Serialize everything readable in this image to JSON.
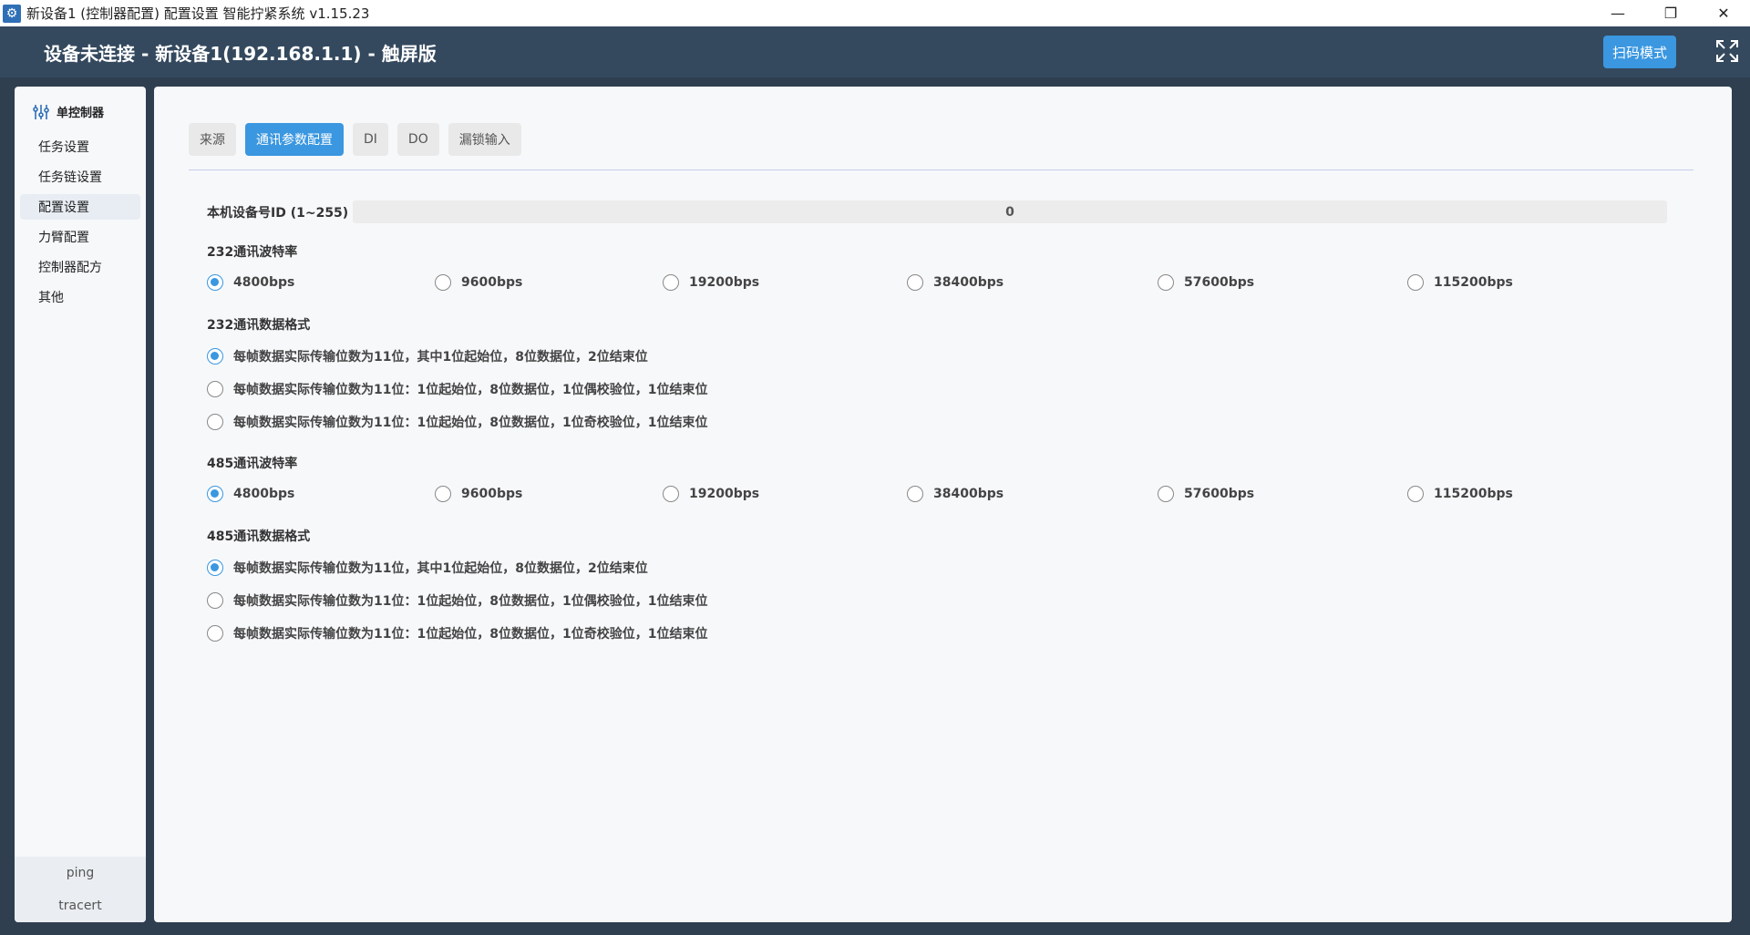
{
  "window": {
    "title": "新设备1 (控制器配置) 配置设置 智能拧紧系统 v1.15.23",
    "controls": [
      "—",
      "❐",
      "✕"
    ]
  },
  "header": {
    "title": "设备未连接 - 新设备1(192.168.1.1) - 触屏版",
    "scan_button": "扫码模式",
    "fullscreen_icon": "fullscreen-icon"
  },
  "sidebar": {
    "heading": "单控制器",
    "items": [
      {
        "label": "任务设置",
        "active": false
      },
      {
        "label": "任务链设置",
        "active": false
      },
      {
        "label": "配置设置",
        "active": true
      },
      {
        "label": "力臂配置",
        "active": false
      },
      {
        "label": "控制器配方",
        "active": false
      },
      {
        "label": "其他",
        "active": false
      }
    ],
    "footer": [
      "ping",
      "tracert"
    ]
  },
  "tabs": [
    {
      "label": "来源",
      "active": false
    },
    {
      "label": "通讯参数配置",
      "active": true
    },
    {
      "label": "DI",
      "active": false
    },
    {
      "label": "DO",
      "active": false
    },
    {
      "label": "漏锁输入",
      "active": false
    }
  ],
  "device_id": {
    "label": "本机设备号ID (1~255)",
    "value": "0"
  },
  "sections": {
    "baud232": {
      "label": "232通讯波特率",
      "options": [
        "4800bps",
        "9600bps",
        "19200bps",
        "38400bps",
        "57600bps",
        "115200bps"
      ],
      "selected": "4800bps"
    },
    "format232": {
      "label": "232通讯数据格式",
      "options": [
        "每帧数据实际传输位数为11位，其中1位起始位，8位数据位，2位结束位",
        "每帧数据实际传输位数为11位：1位起始位，8位数据位，1位偶校验位，1位结束位",
        "每帧数据实际传输位数为11位：1位起始位，8位数据位，1位奇校验位，1位结束位"
      ],
      "selected": "每帧数据实际传输位数为11位，其中1位起始位，8位数据位，2位结束位"
    },
    "baud485": {
      "label": "485通讯波特率",
      "options": [
        "4800bps",
        "9600bps",
        "19200bps",
        "38400bps",
        "57600bps",
        "115200bps"
      ],
      "selected": "4800bps"
    },
    "format485": {
      "label": "485通讯数据格式",
      "options": [
        "每帧数据实际传输位数为11位，其中1位起始位，8位数据位，2位结束位",
        "每帧数据实际传输位数为11位：1位起始位，8位数据位，1位偶校验位，1位结束位",
        "每帧数据实际传输位数为11位：1位起始位，8位数据位，1位奇校验位，1位结束位"
      ],
      "selected": "每帧数据实际传输位数为11位，其中1位起始位，8位数据位，2位结束位"
    }
  },
  "colors": {
    "accent": "#3a97e0",
    "header": "#34495e",
    "panel": "#f6f8fa"
  }
}
